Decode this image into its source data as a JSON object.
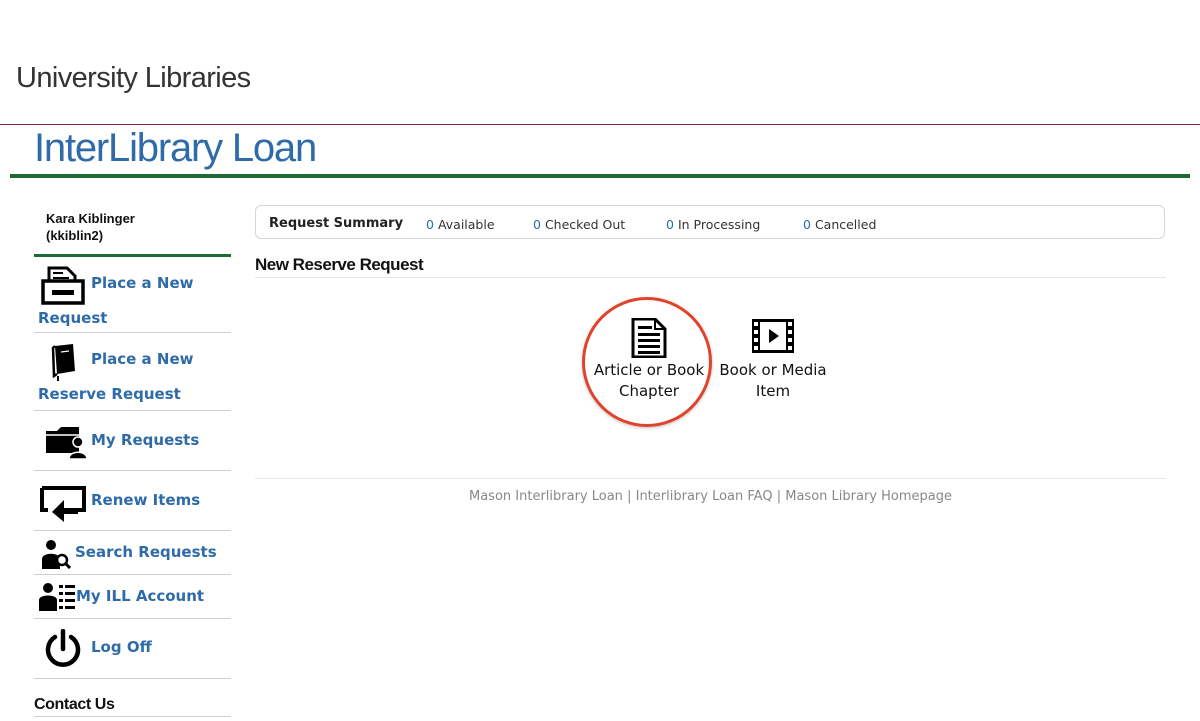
{
  "header": {
    "site_title": "University Libraries",
    "app_title": "InterLibrary Loan"
  },
  "user": {
    "name": "Kara Kiblinger",
    "username": "(kkiblin2)"
  },
  "sidebar": {
    "items": [
      {
        "line1": "Place a New",
        "line2": "Request",
        "icon": "form-drawer-icon"
      },
      {
        "line1": "Place a New",
        "line2": "Reserve Request",
        "icon": "book-icon"
      },
      {
        "line1": "My Requests",
        "icon": "folder-user-icon"
      },
      {
        "line1": "Renew Items",
        "icon": "renew-arrow-icon"
      },
      {
        "line1": "Search Requests",
        "icon": "user-search-icon"
      },
      {
        "line1": "My ILL Account",
        "icon": "user-list-icon"
      },
      {
        "line1": "Log Off",
        "icon": "power-icon"
      }
    ],
    "contact": "Contact Us"
  },
  "summary": {
    "title": "Request Summary",
    "available_count": "0",
    "available_label": "Available",
    "checked_out_count": "0",
    "checked_out_label": "Checked Out",
    "processing_count": "0",
    "processing_label": "In Processing",
    "cancelled_count": "0",
    "cancelled_label": "Cancelled"
  },
  "main": {
    "section_title": "New Reserve Request",
    "choices": [
      {
        "line1": "Article or Book",
        "line2": "Chapter",
        "icon": "document-icon",
        "highlighted": true
      },
      {
        "line1": "Book or Media",
        "line2": "Item",
        "icon": "film-strip-icon",
        "highlighted": false
      }
    ]
  },
  "footer": {
    "links": [
      "Mason Interlibrary Loan",
      "Interlibrary Loan FAQ",
      "Mason Library Homepage"
    ],
    "separator": "|"
  },
  "colors": {
    "accent_blue": "#2e6ba8",
    "rule_green": "#1e6b35",
    "rule_red": "#8a2a2a",
    "highlight_red": "#e0432b"
  }
}
